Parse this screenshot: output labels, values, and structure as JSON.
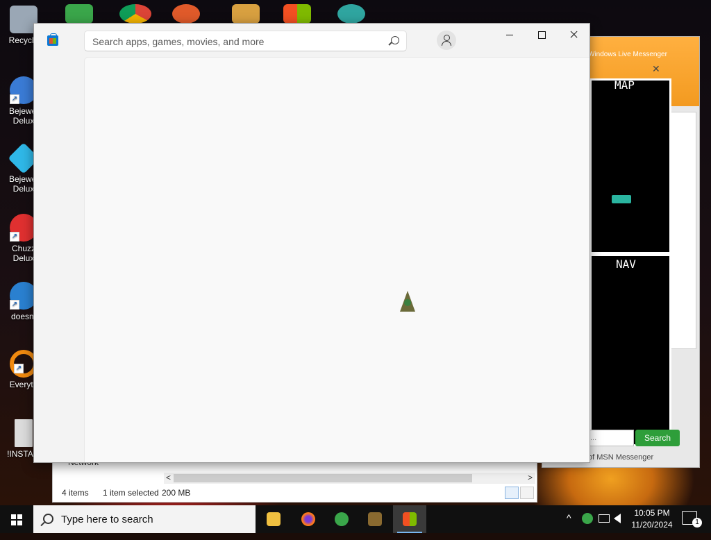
{
  "desktop": {
    "icons": [
      {
        "label": "Recycle",
        "color": "#9aa7b5"
      },
      {
        "label": "Bejewel Delux",
        "color": "#3a7bd5"
      },
      {
        "label": "Bejewel Delux",
        "color": "#2fb8e8"
      },
      {
        "label": "Chuzz Delux",
        "color": "#e03030"
      },
      {
        "label": "doesnt",
        "color": "#2a80d0"
      },
      {
        "label": "Everyth",
        "color": "#f08a10"
      },
      {
        "label": "!INSTALI",
        "color": "#dcdcdc"
      }
    ],
    "shortcut_glyph": "↗"
  },
  "msn": {
    "header_text": "Windows Live Messenger",
    "map_label": "MAP",
    "nav_label": "NAV",
    "search_button": "Search",
    "input_placeholder": "...",
    "footer": "of MSN Messenger",
    "close_glyph": "✕"
  },
  "explorer": {
    "network_label": "Network",
    "status_items": "4 items",
    "status_selected": "1 item selected",
    "status_size": "200 MB",
    "scroll_left": "<",
    "scroll_right": ">"
  },
  "store": {
    "search_placeholder": "Search apps, games, movies, and more",
    "search_value": ""
  },
  "taskbar": {
    "search_text": "Type here to search",
    "time": "10:05 PM",
    "date": "11/20/2024",
    "notification_count": "1",
    "tray_chevron": "^",
    "tray_icons": [
      "msn-tray-icon",
      "network-icon",
      "volume-icon"
    ]
  }
}
